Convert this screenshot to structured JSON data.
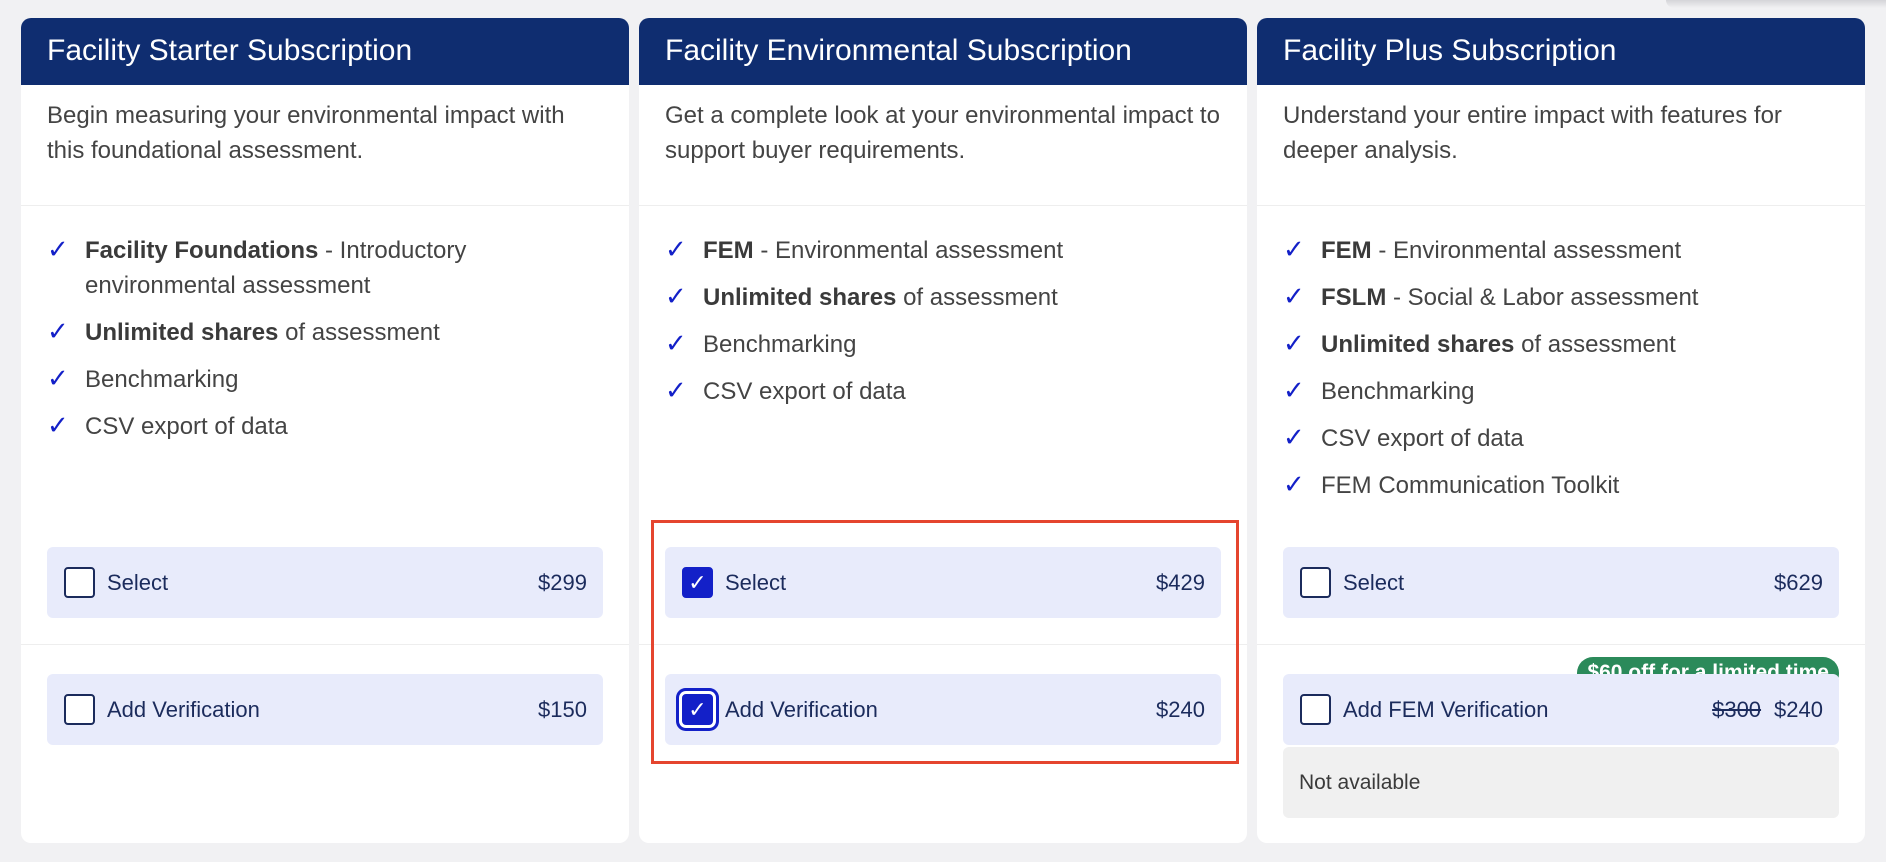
{
  "cards": [
    {
      "title": "Facility Starter Subscription",
      "description": "Begin measuring your environmental impact with this foundational assessment.",
      "features": [
        {
          "bold": "Facility Foundations",
          "text": " - Introductory environmental assessment"
        },
        {
          "bold": "Unlimited shares",
          "text": " of assessment"
        },
        {
          "bold": "",
          "text": "Benchmarking"
        },
        {
          "bold": "",
          "text": "CSV export of data"
        }
      ],
      "select": {
        "label": "Select",
        "price": "$299",
        "checked": false
      },
      "verification": {
        "label": "Add Verification",
        "price": "$150",
        "checked": false
      }
    },
    {
      "title": "Facility Environmental Subscription",
      "description": "Get a complete look at your environmental impact to support buyer requirements.",
      "features": [
        {
          "bold": "FEM",
          "text": " - Environmental assessment"
        },
        {
          "bold": "Unlimited shares",
          "text": " of assessment"
        },
        {
          "bold": "",
          "text": "Benchmarking"
        },
        {
          "bold": "",
          "text": "CSV export of data"
        }
      ],
      "select": {
        "label": "Select",
        "price": "$429",
        "checked": true
      },
      "verification": {
        "label": "Add Verification",
        "price": "$240",
        "checked": true
      }
    },
    {
      "title": "Facility Plus Subscription",
      "description": "Understand your entire impact with features for deeper analysis.",
      "features": [
        {
          "bold": "FEM",
          "text": " - Environmental assessment"
        },
        {
          "bold": "FSLM",
          "text": " - Social & Labor assessment"
        },
        {
          "bold": "Unlimited shares",
          "text": " of assessment"
        },
        {
          "bold": "",
          "text": "Benchmarking"
        },
        {
          "bold": "",
          "text": "CSV export of data"
        },
        {
          "bold": "",
          "text": "FEM Communication Toolkit"
        }
      ],
      "select": {
        "label": "Select",
        "price": "$629",
        "checked": false
      },
      "verification": {
        "label": "Add FEM Verification",
        "old_price": "$300",
        "price": "$240",
        "checked": false
      },
      "promo": "$60 off for a limited time",
      "not_available": "Not available"
    }
  ],
  "icons": {
    "check": "checkmark-icon"
  },
  "colors": {
    "header": "#0f2d70",
    "accent": "#1320c8",
    "promo": "#2b8a5a",
    "highlight": "#e5452f"
  }
}
